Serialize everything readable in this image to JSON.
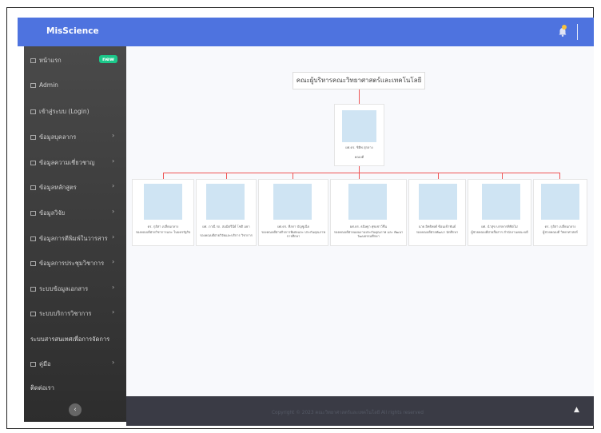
{
  "app": {
    "brand": "MisScience"
  },
  "topbar": {
    "bell_icon": "bell-icon"
  },
  "sidebar": {
    "items": [
      {
        "label": "หน้าแรก",
        "badge": "new"
      },
      {
        "label": "Admin"
      },
      {
        "label": "เข้าสู่ระบบ (Login)"
      },
      {
        "label": "ข้อมูลบุคลากร"
      },
      {
        "label": "ข้อมูลความเชี่ยวชาญ"
      },
      {
        "label": "ข้อมูลหลักสูตร"
      },
      {
        "label": "ข้อมูลวิจัย"
      },
      {
        "label": "ข้อมูลการตีพิมพ์ในวารสาร"
      },
      {
        "label": "ข้อมูลการประชุมวิชาการ"
      },
      {
        "label": "ระบบข้อมูลเอกสาร"
      },
      {
        "label": "ระบบบริการวิชาการ"
      },
      {
        "label": "ระบบสารสนเทศเพื่อการจัดการ"
      },
      {
        "label": "คู่มือ"
      },
      {
        "label": "ติดต่อเรา"
      }
    ],
    "collapse_icon": "chevron-left-icon"
  },
  "org": {
    "title": "คณะผู้บริหารคณะวิทยาศาสตร์และเทคโนโลยี",
    "dean": {
      "name": "ผศ.ดร. ชิติพ สุกลาง",
      "role": "คณบดี"
    },
    "members": [
      {
        "name": "ดร. กุลิสา เปลี่ยนกลาง",
        "role": "รองคณบดีฝ่ายวิชาการและ ในบครรัฐกิจ"
      },
      {
        "name": "ผศ. ภาณี รถ. สมมิตรีนีย์ โชติ มยา",
        "role": "รองคณบดีฝ่ายวิจัยและบริการ วิชาการ"
      },
      {
        "name": "ผศ.ดร. ทีลกา บัญชูเนีย",
        "role": "รองคณบดีฝ่ายกิจการพิเศษและ ประกันคุณภาพการศึกษา"
      },
      {
        "name": "ผศ.ดร. ธนิษฐา ศุขเชาว์ชื่น",
        "role": "รองคณบดีฝ่ายแผนงานประกันคุณภาพ และ พัฒนาวัฒนธรรมศึกษา"
      },
      {
        "name": "นาย อิทธิพงศ์ ซ้อนเข้าพันธ์",
        "role": "รองคณบดีฝ่ายพัฒนา นักศึกษา"
      },
      {
        "name": "ผศ. นำสุข บรรหารพิชิตไม่",
        "role": "ผู้ช่วยคณบดีฝ่ายสื่อสาร สำนักงานคณะบดี"
      },
      {
        "name": "ดร. กุลิสา เปลี่ยนกลาง",
        "role": "ผู้ช่วยคณบดี วิทยาศาสตร์"
      }
    ]
  },
  "footer": {
    "copyright": "Copyright © 2023 คณะวิทยาศาสตร์และเทคโนโลยี All rights reserved",
    "scroll_top_icon": "chevron-up-icon"
  }
}
